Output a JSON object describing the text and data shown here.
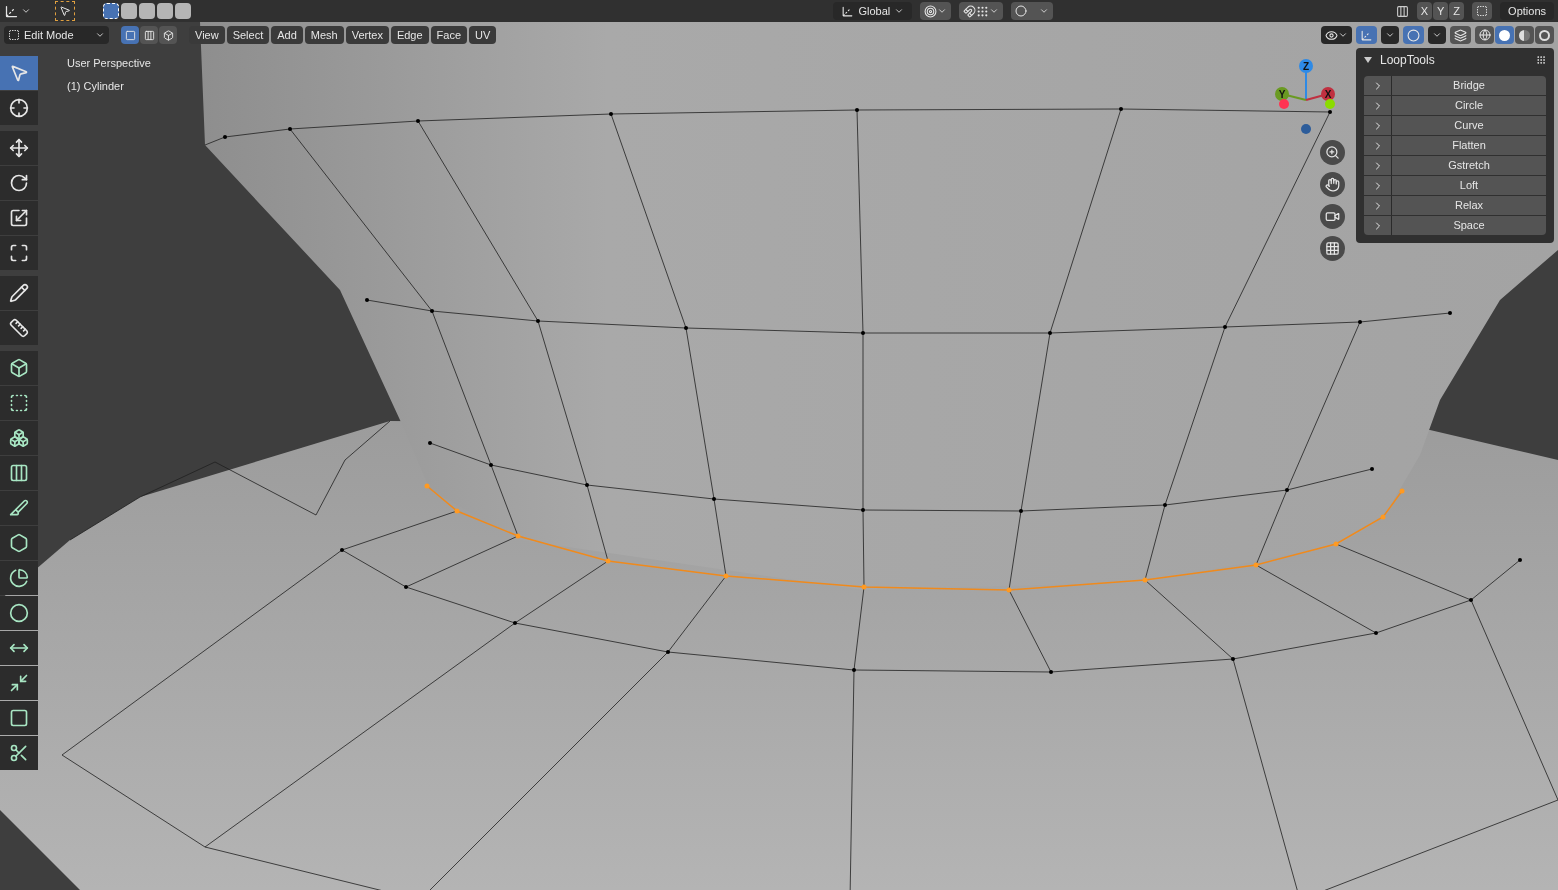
{
  "header": {
    "transform_orientation": "Global",
    "axes": [
      "X",
      "Y",
      "Z"
    ],
    "options": "Options"
  },
  "viewport_header": {
    "mode": "Edit Mode",
    "select_modes": [
      {
        "kind": "vertex",
        "selected": true
      },
      {
        "kind": "edge",
        "selected": false
      },
      {
        "kind": "face",
        "selected": false
      }
    ],
    "menus": [
      "View",
      "Select",
      "Add",
      "Mesh",
      "Vertex",
      "Edge",
      "Face",
      "UV"
    ],
    "shading": [
      {
        "kind": "wireframe",
        "selected": false
      },
      {
        "kind": "solid",
        "selected": true
      },
      {
        "kind": "material",
        "selected": false
      },
      {
        "kind": "rendered",
        "selected": false
      }
    ]
  },
  "overlay_text": [
    "User Perspective",
    "(1) Cylinder"
  ],
  "toolbar": [
    [
      {
        "kind": "select",
        "selected": true
      },
      {
        "kind": "cursor",
        "selected": false
      }
    ],
    [
      {
        "kind": "move",
        "selected": false
      },
      {
        "kind": "rotate",
        "selected": false
      },
      {
        "kind": "scale",
        "selected": false
      },
      {
        "kind": "transform",
        "selected": false
      }
    ],
    [
      {
        "kind": "annotate",
        "selected": false
      },
      {
        "kind": "measure",
        "selected": false
      }
    ],
    [
      {
        "kind": "extrude",
        "selected": false
      },
      {
        "kind": "inset",
        "selected": false
      },
      {
        "kind": "bevel",
        "selected": false
      },
      {
        "kind": "loopcut",
        "selected": false
      },
      {
        "kind": "knife",
        "selected": false
      },
      {
        "kind": "polybuild",
        "selected": false
      },
      {
        "kind": "spin",
        "selected": false
      },
      {
        "kind": "smooth",
        "selected": false
      },
      {
        "kind": "slide",
        "selected": false
      },
      {
        "kind": "shrink",
        "selected": false
      },
      {
        "kind": "shear",
        "selected": false
      },
      {
        "kind": "rip",
        "selected": false
      }
    ]
  ],
  "gizmo": {
    "z": "Z",
    "y": "Y",
    "x": "X"
  },
  "looptools": {
    "title": "LoopTools",
    "expanded": true,
    "items": [
      "Bridge",
      "Circle",
      "Curve",
      "Flatten",
      "Gstretch",
      "Loft",
      "Relax",
      "Space"
    ]
  }
}
